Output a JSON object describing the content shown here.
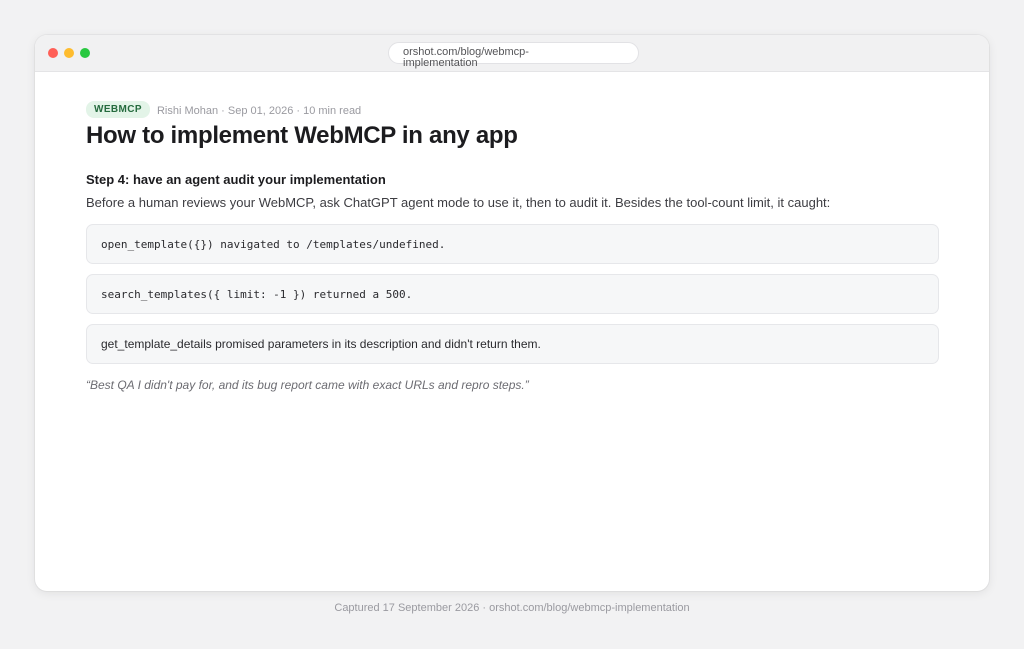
{
  "browser": {
    "url": "orshot.com/blog/webmcp-implementation"
  },
  "article": {
    "tag": "WEBMCP",
    "byline": "Rishi Mohan · Sep 01, 2026 · 10 min read",
    "title": "How to implement WebMCP in any app",
    "step_heading": "Step 4: have an agent audit your implementation",
    "lead": "Before a human reviews your WebMCP, ask ChatGPT agent mode to use it, then to audit it. Besides the tool-count limit, it caught:",
    "findings": [
      "open_template({}) navigated to /templates/undefined.",
      "search_templates({ limit: -1 }) returned a 500.",
      "get_template_details promised parameters in its description and didn't return them."
    ],
    "quote": "“Best QA I didn't pay for, and its bug report came with exact URLs and repro steps.”"
  },
  "footer": {
    "caption": "Captured 17 September 2026 · orshot.com/blog/webmcp-implementation"
  },
  "colors": {
    "tag_bg": "#e3f4e8",
    "tag_text": "#256b3e",
    "traffic_red": "#ff5f57",
    "traffic_yellow": "#febc2e",
    "traffic_green": "#28c840"
  }
}
